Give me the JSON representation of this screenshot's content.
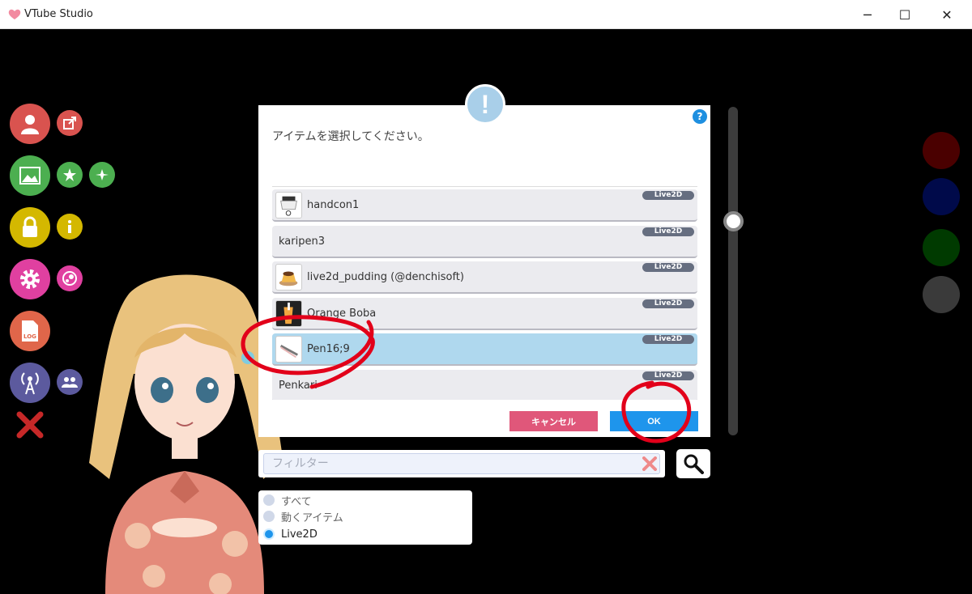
{
  "window": {
    "title": "VTube Studio",
    "minimize_glyph": "─",
    "maximize_glyph": "☐",
    "close_glyph": "✕"
  },
  "dialog": {
    "message": "アイテムを選択してください。",
    "help_glyph": "?",
    "alert_glyph": "!",
    "items": [
      {
        "name": "handcon1",
        "badge": "Live2D",
        "has_thumb": true,
        "selected": false
      },
      {
        "name": "karipen3",
        "badge": "Live2D",
        "has_thumb": false,
        "selected": false
      },
      {
        "name": "live2d_pudding (@denchisoft)",
        "badge": "Live2D",
        "has_thumb": true,
        "selected": false
      },
      {
        "name": "Orange Boba",
        "badge": "Live2D",
        "has_thumb": true,
        "selected": false
      },
      {
        "name": "Pen16;9",
        "badge": "Live2D",
        "has_thumb": true,
        "selected": true
      },
      {
        "name": "Penkari",
        "badge": "Live2D",
        "has_thumb": false,
        "selected": false
      }
    ],
    "cancel_label": "キャンセル",
    "ok_label": "OK"
  },
  "filter": {
    "placeholder": "フィルター",
    "value": ""
  },
  "radio_options": [
    {
      "label": "すべて",
      "selected": false
    },
    {
      "label": "動くアイテム",
      "selected": false
    },
    {
      "label": "Live2D",
      "selected": true
    }
  ],
  "colors": {
    "cancel": "#e0577a",
    "ok": "#1e95ec",
    "selected_row": "#afd8ee",
    "annotation": "#e2001a",
    "sidebar": {
      "profile": "#d9534f",
      "background": "#4caf50",
      "lock": "#d4b800",
      "settings": "#e040a0",
      "log": "#e0664a",
      "stream": "#5c5a9e",
      "dismiss": "#c62828"
    },
    "color_presets": [
      "#4a0000",
      "#000a4a",
      "#003a00",
      "#3a3a3a"
    ]
  },
  "icons": {
    "sidebar": [
      "user-icon",
      "share-icon",
      "image-icon",
      "star-icon",
      "sparkle-icon",
      "lock-icon",
      "info-icon",
      "gear-icon",
      "steam-icon",
      "log-icon",
      "broadcast-icon",
      "people-icon",
      "close-icon"
    ]
  },
  "sidebar_labels": {
    "log": "LOG"
  }
}
